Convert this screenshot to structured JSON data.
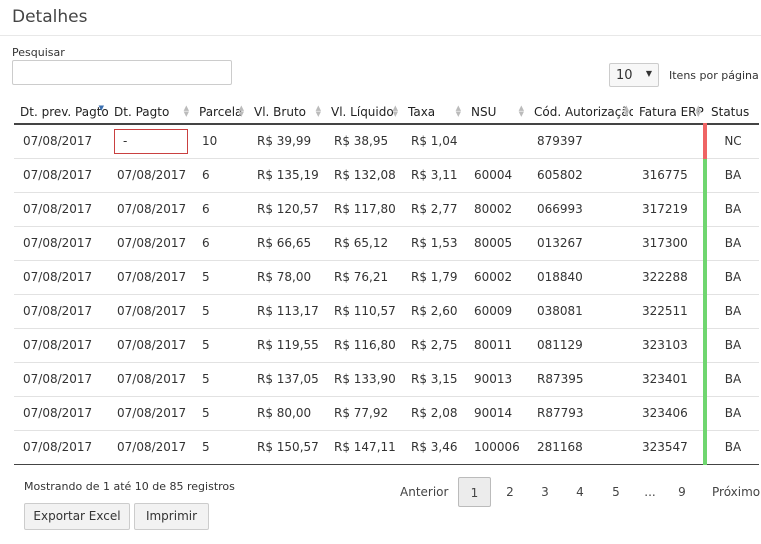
{
  "page": {
    "title": "Detalhes"
  },
  "search": {
    "label": "Pesquisar",
    "value": "",
    "placeholder": ""
  },
  "page_size": {
    "value": "10",
    "label": "Itens por página"
  },
  "table": {
    "columns": [
      "Dt. prev. Pagto",
      "Dt. Pagto",
      "Parcela",
      "Vl. Bruto",
      "Vl. Líquido",
      "Taxa",
      "NSU",
      "Cód. Autorização",
      "Fatura ERP",
      "Status"
    ],
    "rows": [
      {
        "prev": "07/08/2017",
        "pagto": "-",
        "parcela": "10",
        "bruto": "R$ 39,99",
        "liquido": "R$ 38,95",
        "taxa": "R$ 1,04",
        "nsu": "",
        "autorizacao": "879397",
        "fatura": "",
        "status": "NC"
      },
      {
        "prev": "07/08/2017",
        "pagto": "07/08/2017",
        "parcela": "6",
        "bruto": "R$ 135,19",
        "liquido": "R$ 132,08",
        "taxa": "R$ 3,11",
        "nsu": "60004",
        "autorizacao": "605802",
        "fatura": "316775",
        "status": "BA"
      },
      {
        "prev": "07/08/2017",
        "pagto": "07/08/2017",
        "parcela": "6",
        "bruto": "R$ 120,57",
        "liquido": "R$ 117,80",
        "taxa": "R$ 2,77",
        "nsu": "80002",
        "autorizacao": "066993",
        "fatura": "317219",
        "status": "BA"
      },
      {
        "prev": "07/08/2017",
        "pagto": "07/08/2017",
        "parcela": "6",
        "bruto": "R$ 66,65",
        "liquido": "R$ 65,12",
        "taxa": "R$ 1,53",
        "nsu": "80005",
        "autorizacao": "013267",
        "fatura": "317300",
        "status": "BA"
      },
      {
        "prev": "07/08/2017",
        "pagto": "07/08/2017",
        "parcela": "5",
        "bruto": "R$ 78,00",
        "liquido": "R$ 76,21",
        "taxa": "R$ 1,79",
        "nsu": "60002",
        "autorizacao": "018840",
        "fatura": "322288",
        "status": "BA"
      },
      {
        "prev": "07/08/2017",
        "pagto": "07/08/2017",
        "parcela": "5",
        "bruto": "R$ 113,17",
        "liquido": "R$ 110,57",
        "taxa": "R$ 2,60",
        "nsu": "60009",
        "autorizacao": "038081",
        "fatura": "322511",
        "status": "BA"
      },
      {
        "prev": "07/08/2017",
        "pagto": "07/08/2017",
        "parcela": "5",
        "bruto": "R$ 119,55",
        "liquido": "R$ 116,80",
        "taxa": "R$ 2,75",
        "nsu": "80011",
        "autorizacao": "081129",
        "fatura": "323103",
        "status": "BA"
      },
      {
        "prev": "07/08/2017",
        "pagto": "07/08/2017",
        "parcela": "5",
        "bruto": "R$ 137,05",
        "liquido": "R$ 133,90",
        "taxa": "R$ 3,15",
        "nsu": "90013",
        "autorizacao": "R87395",
        "fatura": "323401",
        "status": "BA"
      },
      {
        "prev": "07/08/2017",
        "pagto": "07/08/2017",
        "parcela": "5",
        "bruto": "R$ 80,00",
        "liquido": "R$ 77,92",
        "taxa": "R$ 2,08",
        "nsu": "90014",
        "autorizacao": "R87793",
        "fatura": "323406",
        "status": "BA"
      },
      {
        "prev": "07/08/2017",
        "pagto": "07/08/2017",
        "parcela": "5",
        "bruto": "R$ 150,57",
        "liquido": "R$ 147,11",
        "taxa": "R$ 3,46",
        "nsu": "100006",
        "autorizacao": "281168",
        "fatura": "323547",
        "status": "BA"
      }
    ]
  },
  "footer": {
    "summary": "Mostrando de 1 até 10 de 85 registros",
    "export_label": "Exportar Excel",
    "print_label": "Imprimir"
  },
  "pagination": {
    "prev_label": "Anterior",
    "pages": [
      "1",
      "2",
      "3",
      "4",
      "5",
      "...",
      "9"
    ],
    "current": "1",
    "next_label": "Próximo"
  },
  "colors": {
    "status_ok": "#6fd66f",
    "status_nc": "#ef6464",
    "invalid_border": "#c94040",
    "sort_active": "#3a6fb0"
  }
}
